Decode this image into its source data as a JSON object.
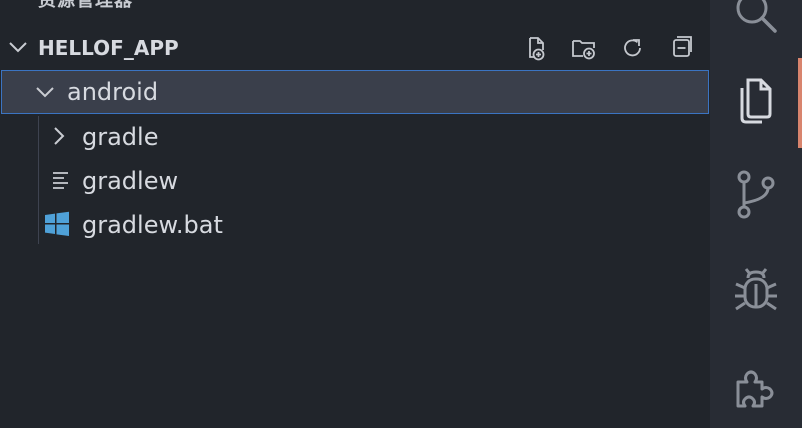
{
  "explorer": {
    "title": "资源管理器",
    "section": {
      "label": "HELLOF_APP",
      "actions": [
        {
          "name": "new-file-button",
          "icon": "new-file-icon"
        },
        {
          "name": "new-folder-button",
          "icon": "new-folder-icon"
        },
        {
          "name": "refresh-button",
          "icon": "refresh-icon"
        },
        {
          "name": "collapse-all-button",
          "icon": "collapse-all-icon"
        }
      ]
    },
    "tree": [
      {
        "label": "android",
        "type": "folder",
        "expanded": true,
        "selected": true
      },
      {
        "label": "gradle",
        "type": "folder",
        "expanded": false
      },
      {
        "label": "gradlew",
        "type": "file",
        "icon": "text-file-icon"
      },
      {
        "label": "gradlew.bat",
        "type": "file",
        "icon": "windows-file-icon"
      }
    ]
  },
  "activity_bar": {
    "items": [
      {
        "name": "search",
        "icon": "search-icon"
      },
      {
        "name": "explorer",
        "icon": "files-icon",
        "active": true
      },
      {
        "name": "source-control",
        "icon": "source-control-icon"
      },
      {
        "name": "run-debug",
        "icon": "bug-icon"
      },
      {
        "name": "extensions",
        "icon": "extensions-icon"
      }
    ]
  },
  "colors": {
    "background": "#21252b",
    "activity_bar": "#282c34",
    "selection": "#3a3f4b",
    "selection_border": "#3b74c2",
    "active_indicator": "#d8846d",
    "windows_icon": "#4fa1d8"
  }
}
